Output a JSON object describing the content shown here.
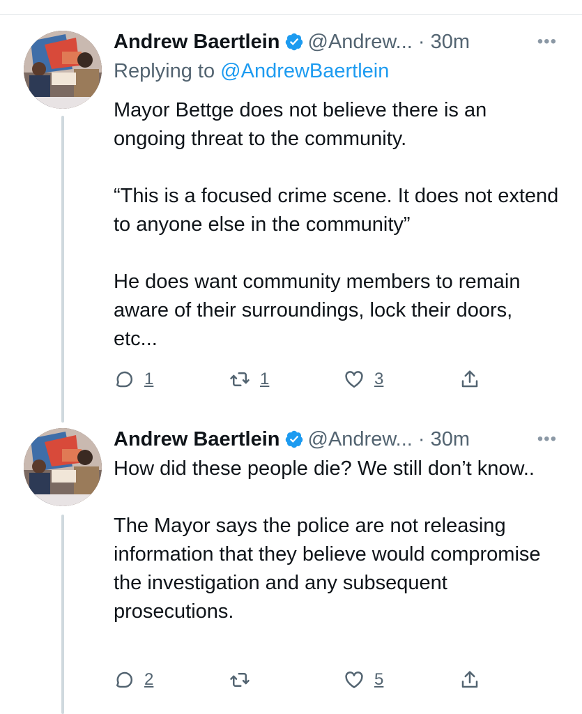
{
  "tweets": [
    {
      "author_name": "Andrew Baertlein",
      "handle": "@Andrew...",
      "separator": "·",
      "time": "30m",
      "more": "•••",
      "replying_prefix": "Replying to",
      "replying_to": "@AndrewBaertlein",
      "paragraphs": [
        "Mayor Bettge does not believe there is an ongoing threat to the community.",
        "“This is a focused crime scene. It does not extend to anyone else in the community”",
        "He does want community members to remain aware of their surroundings, lock their doors, etc..."
      ],
      "reply_count": "1",
      "retweet_count": "1",
      "like_count": "3"
    },
    {
      "author_name": "Andrew Baertlein",
      "handle": "@Andrew...",
      "separator": "·",
      "time": "30m",
      "more": "•••",
      "paragraphs": [
        "How did these people die? We still don’t know..",
        "The Mayor says the police are not releasing information that they believe would compromise the investigation and any subsequent prosecutions."
      ],
      "reply_count": "2",
      "retweet_count": "",
      "like_count": "5"
    }
  ],
  "colors": {
    "accent": "#1d9bf0",
    "secondary_text": "#536471",
    "thread_line": "#cfd9de"
  },
  "icons": [
    "verified-badge-icon",
    "more-icon",
    "reply-icon",
    "retweet-icon",
    "like-icon",
    "share-icon"
  ]
}
